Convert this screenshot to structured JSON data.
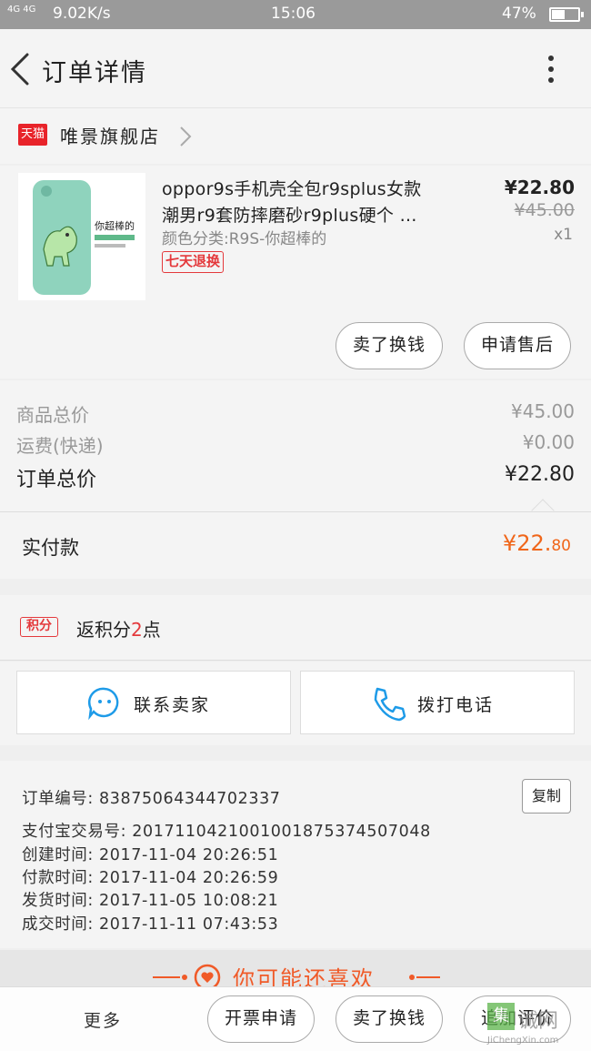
{
  "status_bar": {
    "network": "4G 4G",
    "speed": "9.02K/s",
    "time": "15:06",
    "battery": "47%"
  },
  "header": {
    "title": "订单详情"
  },
  "shop": {
    "badge": "天猫",
    "name": "唯景旗舰店"
  },
  "product": {
    "title_line1": "oppor9s手机壳全包r9splus女款",
    "title_line2": "潮男r9套防摔磨砂r9plus硬个 …",
    "sku": "颜色分类:R9S-你超棒的",
    "tag": "七天退换",
    "price": "¥22.80",
    "original_price": "¥45.00",
    "quantity": "x1",
    "thumb_caption": "你超棒的",
    "actions": [
      "卖了换钱",
      "申请售后"
    ]
  },
  "summary": {
    "goods_label": "商品总价",
    "goods_value": "¥45.00",
    "shipping_label": "运费(快递)",
    "shipping_value": "¥0.00",
    "total_label": "订单总价",
    "total_value": "¥22.80",
    "paid_label": "实付款",
    "paid_main": "¥22.",
    "paid_cents": "80"
  },
  "points": {
    "badge": "积分",
    "text_prefix": "返积分",
    "value": "2",
    "text_suffix": "点"
  },
  "contact": {
    "seller_label": "联系卖家",
    "call_label": "拨打电话"
  },
  "order_info": {
    "order_no": "订单编号: 83875064344702337",
    "copy_label": "复制",
    "alipay_no": "支付宝交易号: 2017110421001001875374507048",
    "created": "创建时间: 2017-11-04  20:26:51",
    "paid": "付款时间: 2017-11-04  20:26:59",
    "shipped": "发货时间: 2017-11-05  10:08:21",
    "completed": "成交时间: 2017-11-11  07:43:53"
  },
  "recommend": {
    "title": "你可能还喜欢"
  },
  "bottom_bar": {
    "more": "更多",
    "buttons": [
      "开票申请",
      "卖了换钱",
      "追加评价"
    ]
  },
  "watermark": {
    "badge": "集",
    "text": "诚网",
    "site": "JiChengXin.com"
  },
  "colors": {
    "accent_red": "#e4393c",
    "paid_orange": "#f0661a",
    "icon_blue": "#1e9be8"
  }
}
